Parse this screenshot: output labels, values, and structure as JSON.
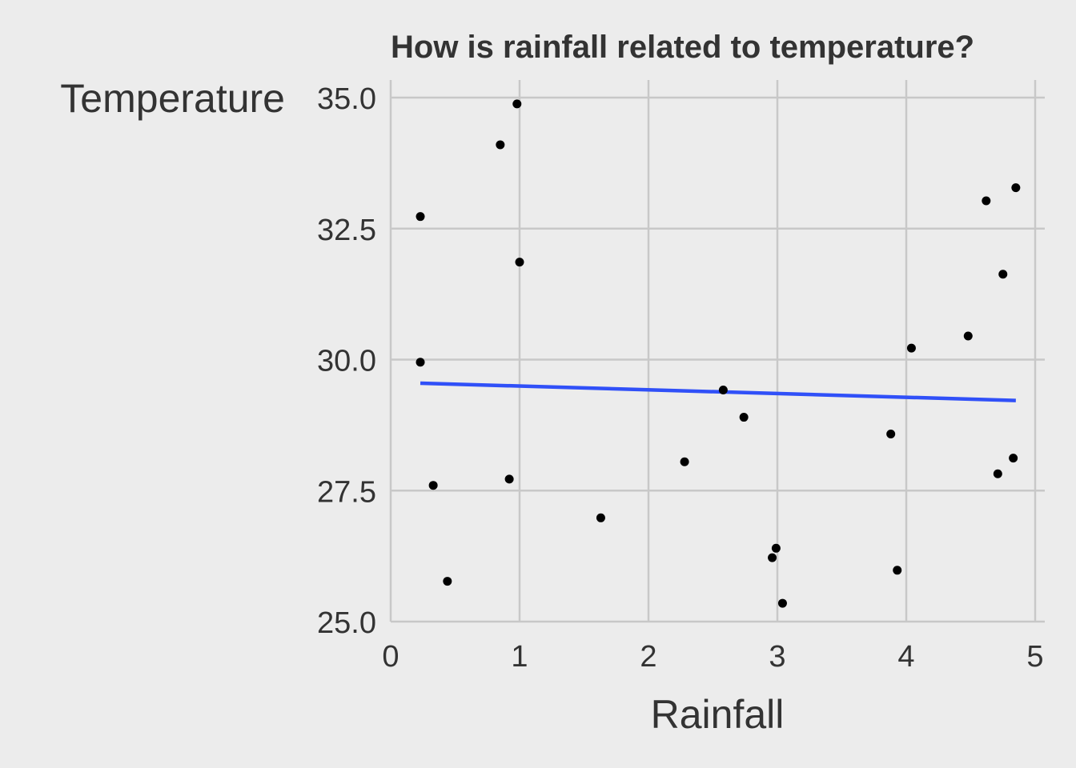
{
  "chart_data": {
    "type": "scatter",
    "title": "How is rainfall related to temperature?",
    "xlabel": "Rainfall",
    "ylabel": "Temperature",
    "xlim": [
      0,
      5
    ],
    "ylim": [
      25,
      35
    ],
    "x_ticks": [
      "0",
      "1",
      "2",
      "3",
      "4",
      "5"
    ],
    "y_ticks": [
      "25.0",
      "27.5",
      "30.0",
      "32.5",
      "35.0"
    ],
    "grid": true,
    "colors": {
      "background": "#ececec",
      "grid": "#c8c8c8",
      "points": "#000000",
      "trend_line": "#3050f8",
      "text": "#333333"
    },
    "points": [
      {
        "x": 0.98,
        "y": 34.88
      },
      {
        "x": 0.85,
        "y": 34.1
      },
      {
        "x": 0.23,
        "y": 32.73
      },
      {
        "x": 1.0,
        "y": 31.86
      },
      {
        "x": 0.23,
        "y": 29.95
      },
      {
        "x": 0.33,
        "y": 27.6
      },
      {
        "x": 0.92,
        "y": 27.72
      },
      {
        "x": 0.44,
        "y": 25.77
      },
      {
        "x": 1.63,
        "y": 26.98
      },
      {
        "x": 2.28,
        "y": 28.05
      },
      {
        "x": 2.58,
        "y": 29.42
      },
      {
        "x": 2.74,
        "y": 28.9
      },
      {
        "x": 2.96,
        "y": 26.22
      },
      {
        "x": 2.99,
        "y": 26.4
      },
      {
        "x": 3.04,
        "y": 25.35
      },
      {
        "x": 3.88,
        "y": 28.58
      },
      {
        "x": 3.93,
        "y": 25.98
      },
      {
        "x": 4.04,
        "y": 30.22
      },
      {
        "x": 4.48,
        "y": 30.45
      },
      {
        "x": 4.62,
        "y": 33.03
      },
      {
        "x": 4.71,
        "y": 27.82
      },
      {
        "x": 4.75,
        "y": 31.63
      },
      {
        "x": 4.83,
        "y": 28.12
      },
      {
        "x": 4.85,
        "y": 33.28
      }
    ],
    "trend_line": {
      "type": "linear",
      "x": [
        0.23,
        4.85
      ],
      "y": [
        29.55,
        29.22
      ]
    }
  }
}
